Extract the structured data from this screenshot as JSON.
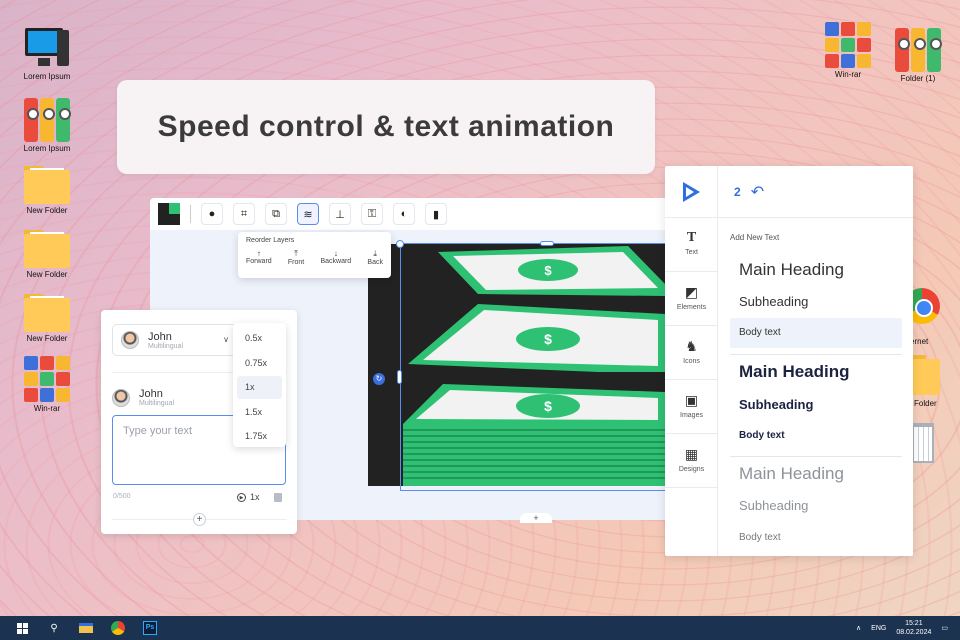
{
  "title_card": {
    "text": "Speed control & text animation"
  },
  "desktop_icons": [
    {
      "label": "Lorem Ipsum"
    },
    {
      "label": "Lorem Ipsum"
    },
    {
      "label": "New Folder"
    },
    {
      "label": "New Folder"
    },
    {
      "label": "New Folder"
    },
    {
      "label": "Win-rar"
    },
    {
      "label": "Win-rar"
    },
    {
      "label": "Folder (1)"
    }
  ],
  "partial_icons": {
    "chrome_label": "ernet",
    "folder_label": "Folder"
  },
  "reorder_layers": {
    "title": "Reorder Layers",
    "items": [
      {
        "label": "Forward",
        "glyph": "↑"
      },
      {
        "label": "Front",
        "glyph": "⤒"
      },
      {
        "label": "Backward",
        "glyph": "↓"
      },
      {
        "label": "Back",
        "glyph": "⤓"
      }
    ]
  },
  "voice_panel": {
    "voice_name": "John",
    "voice_language": "Multilingual",
    "row_name": "John",
    "row_language": "Multilingual",
    "text_placeholder": "Type your text",
    "char_counter": "0/500",
    "speed_value": "1x",
    "add_symbol": "+"
  },
  "speed_menu": {
    "options": [
      "0.5x",
      "0.75x",
      "1x",
      "1.5x",
      "1.75x"
    ],
    "selected": "1x"
  },
  "text_panel": {
    "counter": "2",
    "tabs": [
      {
        "label": "Text",
        "icon": "text-icon"
      },
      {
        "label": "Elements",
        "icon": "elements-icon"
      },
      {
        "label": "Icons",
        "icon": "icons-icon"
      },
      {
        "label": "Images",
        "icon": "images-icon"
      },
      {
        "label": "Designs",
        "icon": "designs-icon"
      }
    ],
    "add_new_text": "Add New Text",
    "group_regular": {
      "heading": "Main Heading",
      "subheading": "Subheading",
      "body": "Body text"
    },
    "group_bold": {
      "heading": "Main Heading",
      "subheading": "Subheading",
      "body": "Body text"
    },
    "group_light": {
      "heading": "Main Heading",
      "subheading": "Subheading",
      "body": "Body text"
    }
  },
  "taskbar": {
    "language": "ENG",
    "time": "15:21",
    "date": "08.02.2024",
    "photoshop_label": "Ps"
  },
  "colors": {
    "accent": "#2f6fe0",
    "money_green": "#2fc173",
    "image_bg": "#222222"
  }
}
